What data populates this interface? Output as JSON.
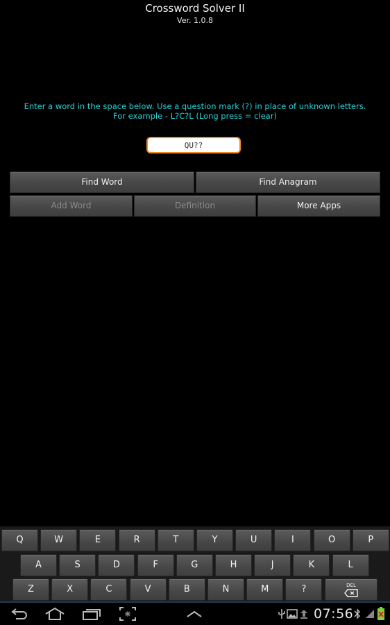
{
  "app": {
    "title": "Crossword Solver II",
    "version": "Ver. 1.0.8"
  },
  "instructions": {
    "line1": "Enter a word in the space below. Use a question mark (?) in place of unknown letters.",
    "line2": "For example - L?C?L (Long press = clear)"
  },
  "word_input": {
    "value": "QU??",
    "border_color": "#f08a1c"
  },
  "buttons": {
    "find_word": "Find Word",
    "find_anagram": "Find Anagram",
    "add_word": "Add Word",
    "definition": "Definition",
    "more_apps": "More Apps"
  },
  "keyboard": {
    "row1": [
      "Q",
      "W",
      "E",
      "R",
      "T",
      "Y",
      "U",
      "I",
      "O",
      "P"
    ],
    "row2": [
      "A",
      "S",
      "D",
      "F",
      "G",
      "H",
      "J",
      "K",
      "L"
    ],
    "row3": [
      "Z",
      "X",
      "C",
      "V",
      "B",
      "N",
      "M",
      "?"
    ],
    "del_label": "DEL"
  },
  "navbar": {
    "icons": [
      "back-icon",
      "home-icon",
      "recent-apps-icon",
      "screenshot-icon",
      "menu-up-icon"
    ]
  },
  "status": {
    "time": "07:56",
    "icons": [
      "usb-icon",
      "gallery-icon",
      "upload-icon",
      "bluetooth-icon",
      "signal-icon",
      "battery-icon"
    ]
  },
  "colors": {
    "instructions_text": "#2ad0d8",
    "background": "#000000"
  }
}
